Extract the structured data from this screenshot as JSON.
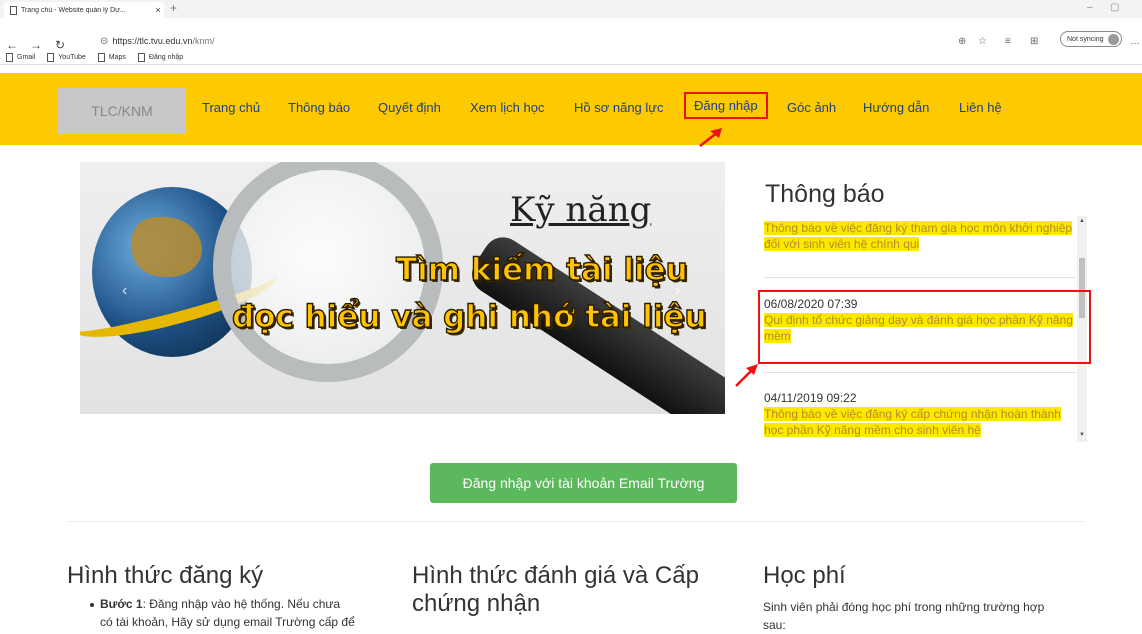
{
  "browser": {
    "tab_title": "Trang chủ - Website quản lý Dự...",
    "new_tab": "+",
    "tab_close": "×",
    "url_host": "https://tlc.tvu.edu.vn",
    "url_path": "/knm/",
    "sync_label": "Not syncing",
    "bookmarks": [
      "Gmail",
      "YouTube",
      "Maps",
      "Đăng nhập"
    ]
  },
  "site": {
    "logo": "TLC/KNM",
    "nav": [
      "Trang chủ",
      "Thông báo",
      "Quyết định",
      "Xem lịch học",
      "Hồ sơ năng lực",
      "Đăng nhập",
      "Góc ảnh",
      "Hướng dẫn",
      "Liên hệ"
    ],
    "annotation_color": "#e11111",
    "accent": "#fdc900"
  },
  "banner": {
    "title": "Kỹ năng",
    "line1": "Tìm kiếm tài liệu",
    "line2": "đọc hiểu và ghi nhớ tài liệu"
  },
  "notices": {
    "heading": "Thông báo",
    "items": [
      {
        "date": "",
        "text": "Thông báo về việc đăng ký tham gia học môn khởi nghiệp đối với sinh viên hệ chính qui"
      },
      {
        "date": "06/08/2020 07:39",
        "text": "Qui định tổ chức giảng dạy và đánh giá học phần Kỹ năng mềm"
      },
      {
        "date": "04/11/2019 09:22",
        "text": "Thông báo về việc đăng ký cấp chứng nhận hoàn thành học phần Kỹ năng mềm cho sinh viên hệ"
      }
    ]
  },
  "login_button": "Đăng nhập với tài khoản Email Trường",
  "columns": {
    "register": {
      "title": "Hình thức đăng ký",
      "step_label": "Bước 1",
      "step_text": ": Đăng nhập vào hệ thống. Nếu chưa",
      "step_text2": "có tài khoản, Hãy sử dụng email Trường cấp để"
    },
    "assess": {
      "title_line1": "Hình thức đánh giá và Cấp",
      "title_line2": "chứng nhận"
    },
    "fee": {
      "title": "Học phí",
      "text": "Sinh viên phải đóng học phí trong những trường hợp",
      "text2": "sau:"
    }
  }
}
